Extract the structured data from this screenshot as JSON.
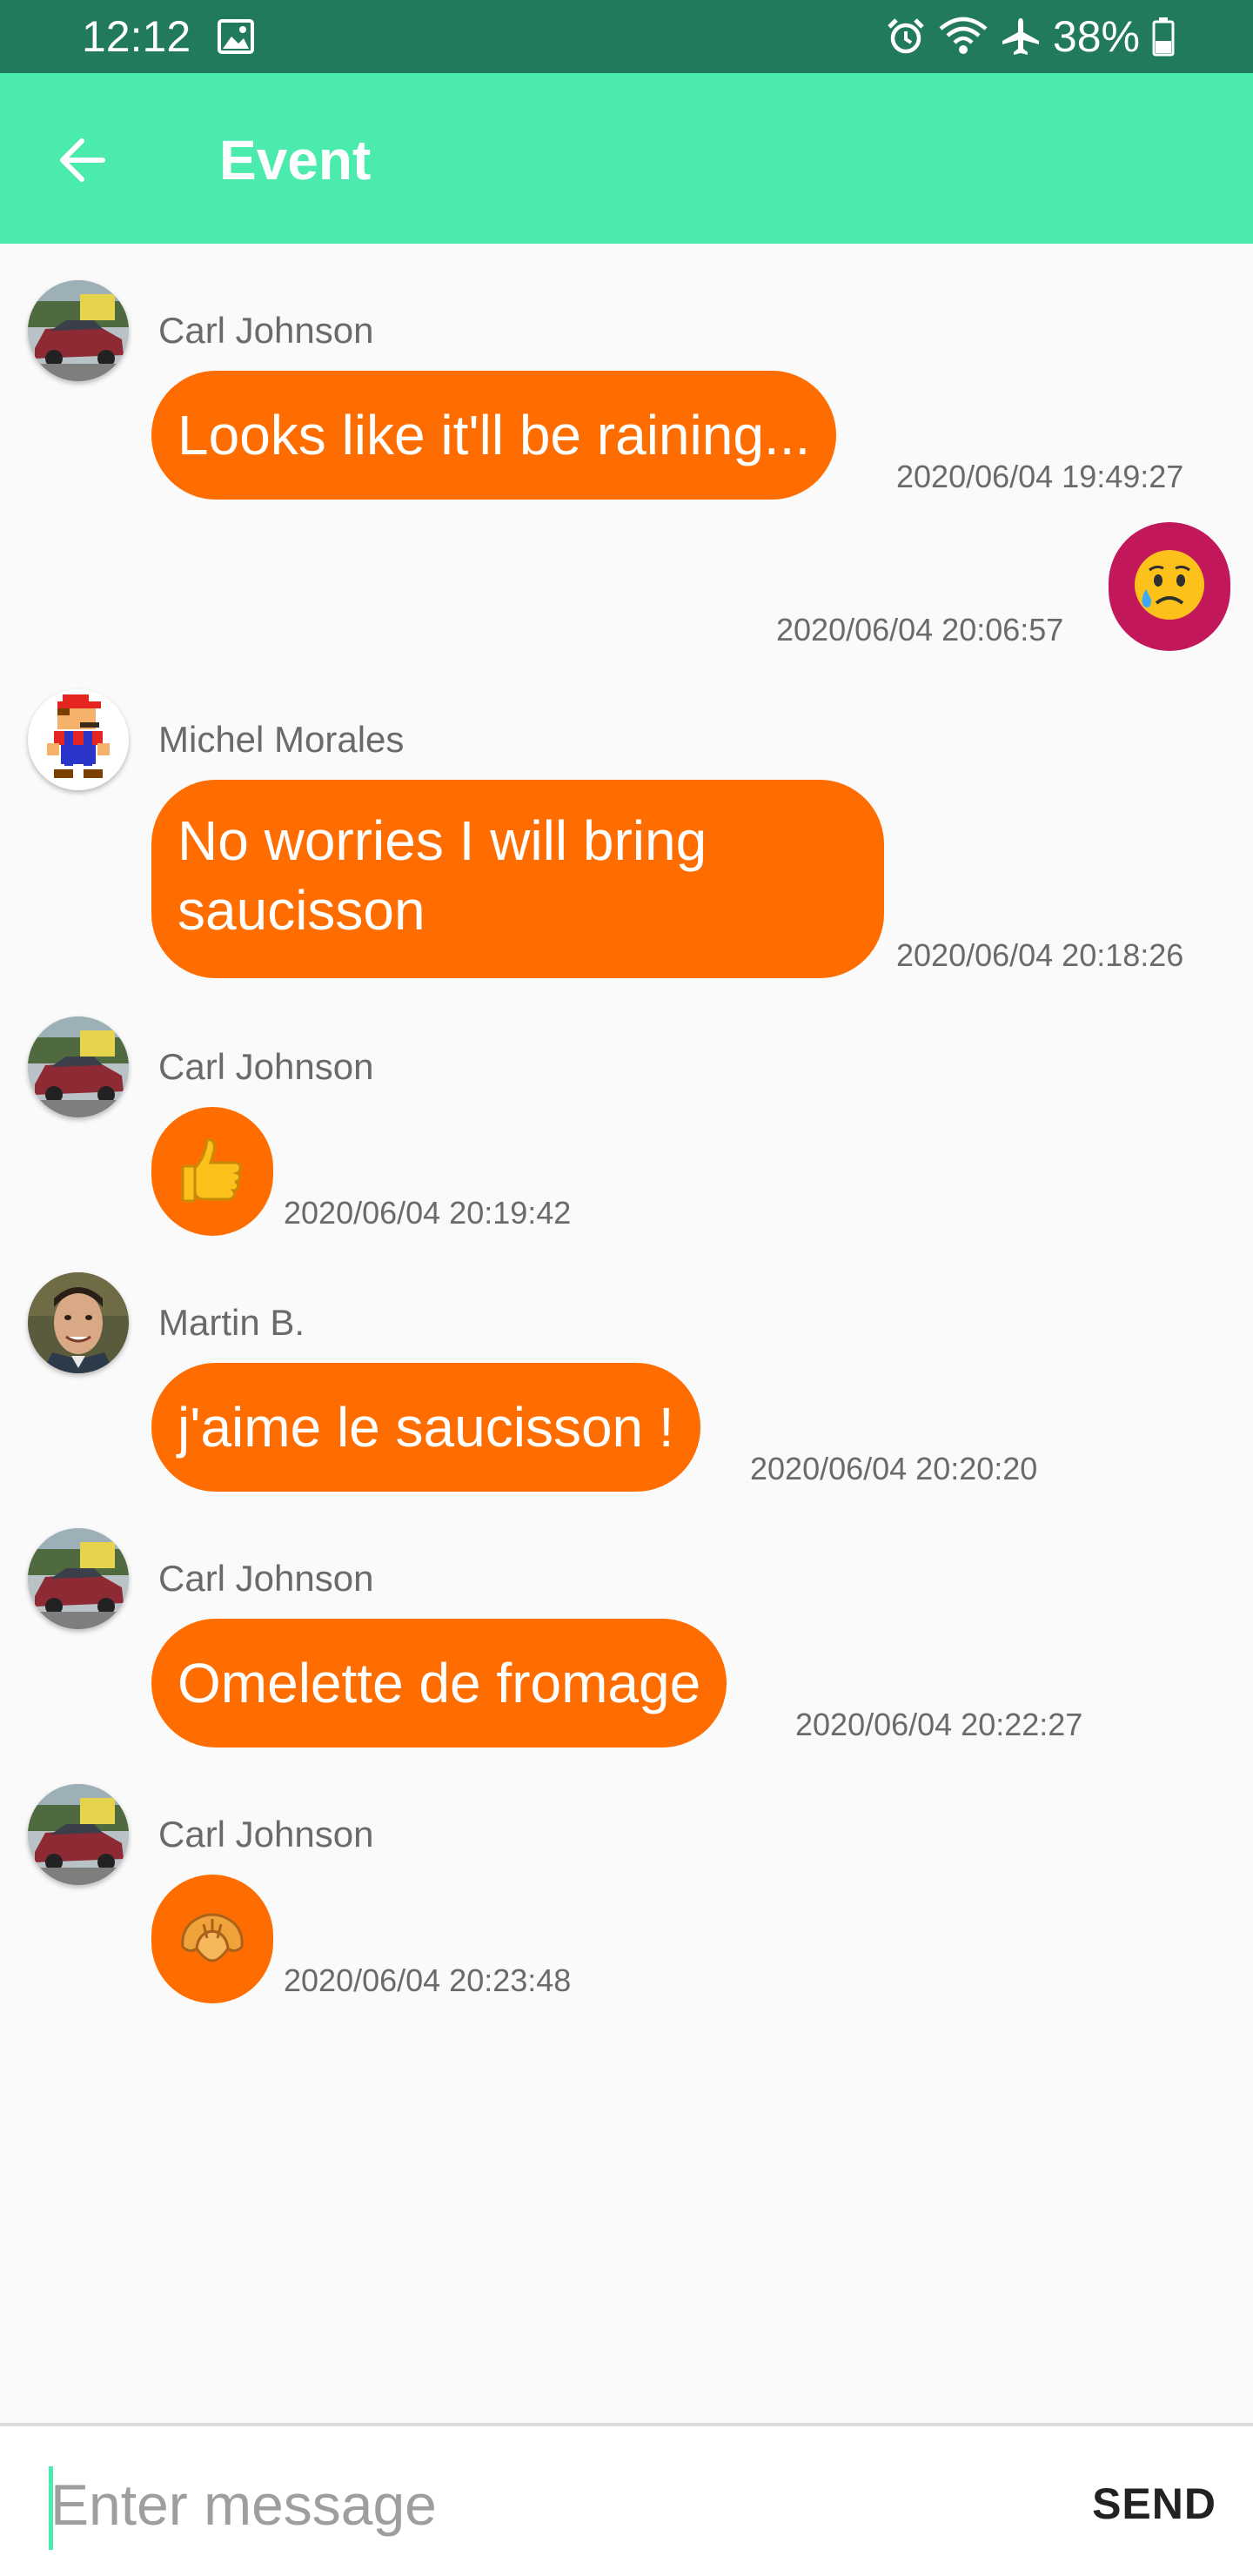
{
  "status_bar": {
    "time": "12:12",
    "battery": "38%",
    "icons": [
      "image-icon",
      "alarm-icon",
      "wifi-icon",
      "airplane-icon",
      "battery-icon"
    ]
  },
  "app_bar": {
    "title": "Event",
    "back_icon": "arrow-left-icon"
  },
  "messages": [
    {
      "sender": "Carl Johnson",
      "avatar": "car-avatar",
      "text": "Looks like it'll be raining...",
      "timestamp": "2020/06/04 19:49:27"
    },
    {
      "own": true,
      "emoji": "sad-sweat-face-icon",
      "timestamp": "2020/06/04 20:06:57"
    },
    {
      "sender": "Michel Morales",
      "avatar": "pixel-plumber-avatar",
      "text": "No worries I will bring saucisson",
      "timestamp": "2020/06/04 20:18:26"
    },
    {
      "sender": "Carl Johnson",
      "avatar": "car-avatar",
      "emoji": "thumbs-up-icon",
      "timestamp": "2020/06/04 20:19:42"
    },
    {
      "sender": "Martin B.",
      "avatar": "man-portrait-avatar",
      "text": "j'aime le saucisson !",
      "timestamp": "2020/06/04 20:20:20"
    },
    {
      "sender": "Carl Johnson",
      "avatar": "car-avatar",
      "text": "Omelette de fromage",
      "timestamp": "2020/06/04 20:22:27"
    },
    {
      "sender": "Carl Johnson",
      "avatar": "car-avatar",
      "emoji": "croissant-icon",
      "timestamp": "2020/06/04 20:23:48"
    }
  ],
  "input": {
    "placeholder": "Enter message",
    "value": "",
    "send_label": "SEND"
  },
  "colors": {
    "status_bar": "#217a5a",
    "app_bar": "#4beaad",
    "bubble": "#ff6d00",
    "own_bubble": "#c2185b",
    "background": "#fafafa"
  }
}
